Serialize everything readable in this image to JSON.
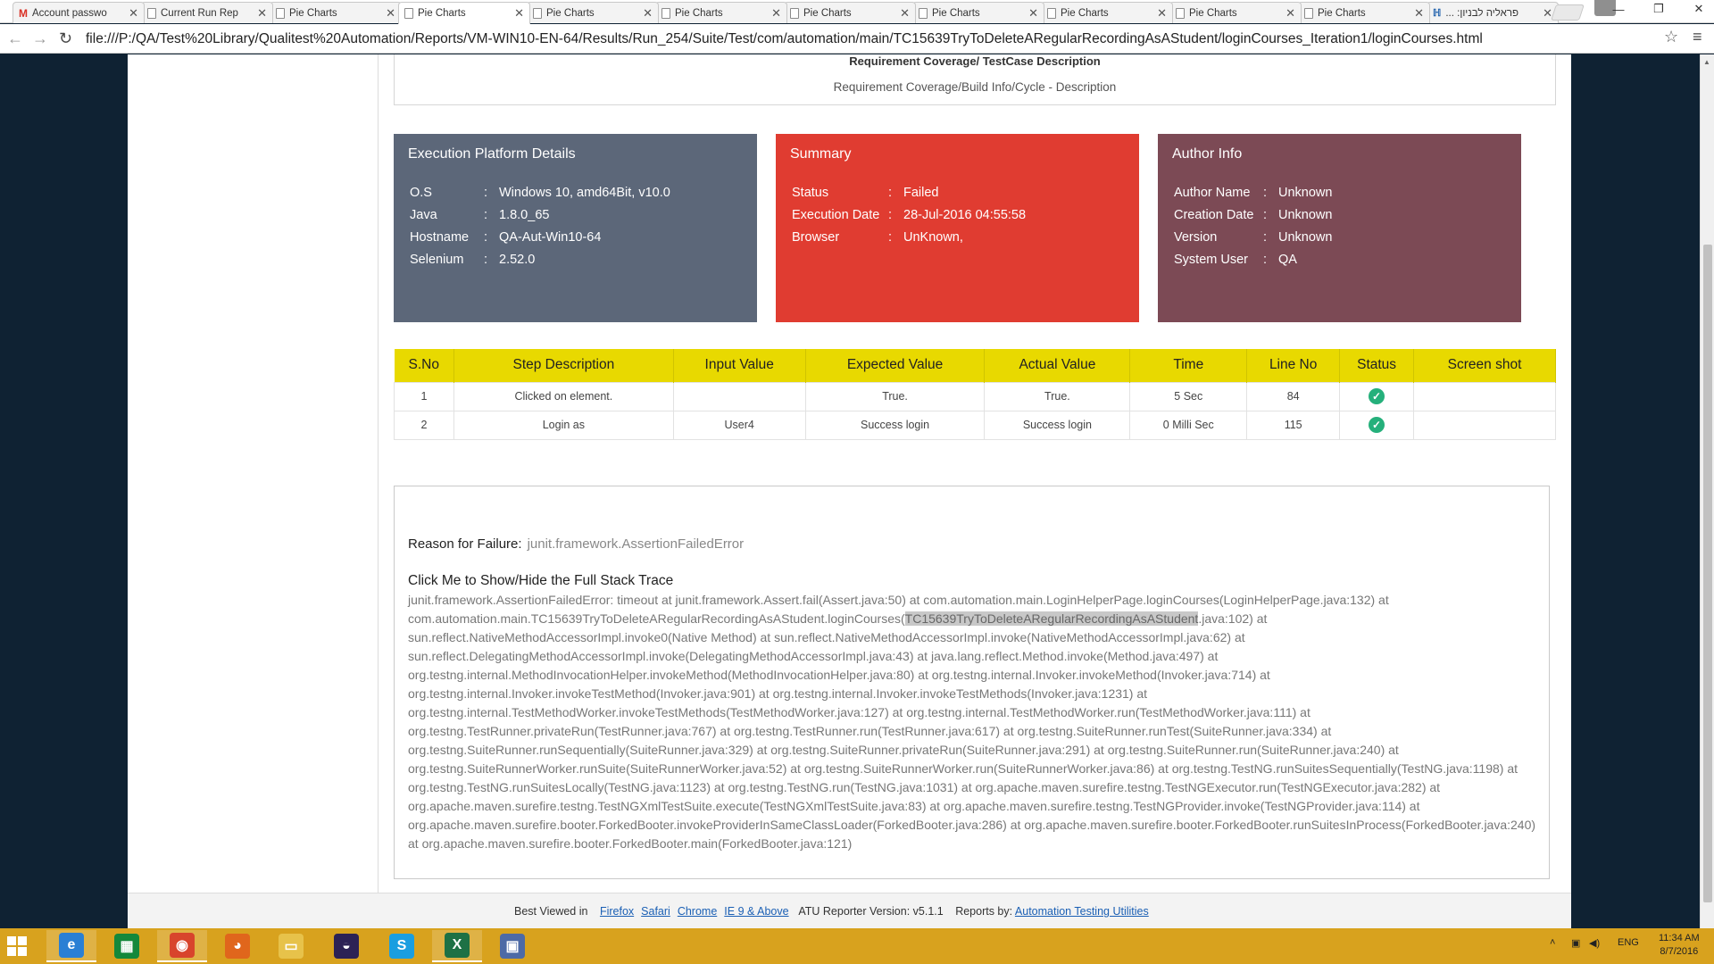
{
  "browser": {
    "tabs": [
      {
        "title": "Account passwo",
        "icon": "gmail-icon"
      },
      {
        "title": "Current Run Rep",
        "icon": "document-icon"
      },
      {
        "title": "Pie Charts",
        "icon": "document-icon"
      },
      {
        "title": "Pie Charts",
        "icon": "document-icon",
        "active": true
      },
      {
        "title": "Pie Charts",
        "icon": "document-icon"
      },
      {
        "title": "Pie Charts",
        "icon": "document-icon"
      },
      {
        "title": "Pie Charts",
        "icon": "document-icon"
      },
      {
        "title": "Pie Charts",
        "icon": "document-icon"
      },
      {
        "title": "Pie Charts",
        "icon": "document-icon"
      },
      {
        "title": "Pie Charts",
        "icon": "document-icon"
      },
      {
        "title": "Pie Charts",
        "icon": "document-icon"
      },
      {
        "title": "פראליה לבניון: ...",
        "icon": "app-icon"
      }
    ],
    "tab_close_glyph": "✕",
    "url": "file:///P:/QA/Test%20Library/Qualitest%20Automation/Reports/VM-WIN10-EN-64/Results/Run_254/Suite/Test/com/automation/main/TC15639TryToDeleteARegularRecordingAsAStudent/loginCourses_Iteration1/loginCourses.html",
    "controls": {
      "back": "←",
      "forward": "→",
      "reload": "↻",
      "star": "☆",
      "menu": "≡",
      "minimize": "—",
      "restore": "❐",
      "close": "✕"
    }
  },
  "report": {
    "description_title": "Requirement Coverage/ TestCase Description",
    "description_text": "Requirement Coverage/Build Info/Cycle - Description",
    "platform": {
      "title": "Execution Platform Details",
      "color": "#5c6779",
      "rows": [
        {
          "key": "O.S",
          "value": "Windows 10, amd64Bit, v10.0"
        },
        {
          "key": "Java",
          "value": "1.8.0_65"
        },
        {
          "key": "Hostname",
          "value": "QA-Aut-Win10-64"
        },
        {
          "key": "Selenium",
          "value": "2.52.0"
        }
      ]
    },
    "summary": {
      "title": "Summary",
      "color": "#e03c31",
      "rows": [
        {
          "key": "Status",
          "value": "Failed"
        },
        {
          "key": "Execution Date",
          "value": "28-Jul-2016 04:55:58"
        },
        {
          "key": "Browser",
          "value": "UnKnown,"
        }
      ]
    },
    "author": {
      "title": "Author Info",
      "color": "#7c4a55",
      "rows": [
        {
          "key": "Author Name",
          "value": "Unknown"
        },
        {
          "key": "Creation Date",
          "value": "Unknown"
        },
        {
          "key": "Version",
          "value": "Unknown"
        },
        {
          "key": "System User",
          "value": "QA"
        }
      ]
    },
    "separator": ":",
    "steps_table": {
      "header_color": "#e8d900",
      "headers": [
        "S.No",
        "Step Description",
        "Input Value",
        "Expected Value",
        "Actual Value",
        "Time",
        "Line No",
        "Status",
        "Screen shot"
      ],
      "rows": [
        {
          "sno": "1",
          "step": "Clicked on element.",
          "input": "",
          "expected": "True.",
          "actual": "True.",
          "time": "5 Sec",
          "line": "84",
          "status": "passed",
          "screenshot": ""
        },
        {
          "sno": "2",
          "step": "Login as",
          "input": "User4",
          "expected": "Success login",
          "actual": "Success login",
          "time": "0 Milli Sec",
          "line": "115",
          "status": "passed",
          "screenshot": ""
        }
      ],
      "status_glyph": "✓"
    },
    "failure": {
      "reason_label": "Reason for Failure:",
      "reason_value": "junit.framework.AssertionFailedError",
      "toggle_label": "Click Me to Show/Hide the Full Stack Trace",
      "stack_before": "junit.framework.AssertionFailedError: timeout at junit.framework.Assert.fail(Assert.java:50) at com.automation.main.LoginHelperPage.loginCourses(LoginHelperPage.java:132) at com.automation.main.TC15639TryToDeleteARegularRecordingAsAStudent.loginCourses(",
      "stack_highlight": "TC15639TryToDeleteARegularRecordingAsAStudent",
      "stack_after": ".java:102) at sun.reflect.NativeMethodAccessorImpl.invoke0(Native Method) at sun.reflect.NativeMethodAccessorImpl.invoke(NativeMethodAccessorImpl.java:62) at sun.reflect.DelegatingMethodAccessorImpl.invoke(DelegatingMethodAccessorImpl.java:43) at java.lang.reflect.Method.invoke(Method.java:497) at org.testng.internal.MethodInvocationHelper.invokeMethod(MethodInvocationHelper.java:80) at org.testng.internal.Invoker.invokeMethod(Invoker.java:714) at org.testng.internal.Invoker.invokeTestMethod(Invoker.java:901) at org.testng.internal.Invoker.invokeTestMethods(Invoker.java:1231) at org.testng.internal.TestMethodWorker.invokeTestMethods(TestMethodWorker.java:127) at org.testng.internal.TestMethodWorker.run(TestMethodWorker.java:111) at org.testng.TestRunner.privateRun(TestRunner.java:767) at org.testng.TestRunner.run(TestRunner.java:617) at org.testng.SuiteRunner.runTest(SuiteRunner.java:334) at org.testng.SuiteRunner.runSequentially(SuiteRunner.java:329) at org.testng.SuiteRunner.privateRun(SuiteRunner.java:291) at org.testng.SuiteRunner.run(SuiteRunner.java:240) at org.testng.SuiteRunnerWorker.runSuite(SuiteRunnerWorker.java:52) at org.testng.SuiteRunnerWorker.run(SuiteRunnerWorker.java:86) at org.testng.TestNG.runSuitesSequentially(TestNG.java:1198) at org.testng.TestNG.runSuitesLocally(TestNG.java:1123) at org.testng.TestNG.run(TestNG.java:1031) at org.apache.maven.surefire.testng.TestNGExecutor.run(TestNGExecutor.java:282) at org.apache.maven.surefire.testng.TestNGXmlTestSuite.execute(TestNGXmlTestSuite.java:83) at org.apache.maven.surefire.testng.TestNGProvider.invoke(TestNGProvider.java:114) at org.apache.maven.surefire.booter.ForkedBooter.invokeProviderInSameClassLoader(ForkedBooter.java:286) at org.apache.maven.surefire.booter.ForkedBooter.runSuitesInProcess(ForkedBooter.java:240) at org.apache.maven.surefire.booter.ForkedBooter.main(ForkedBooter.java:121)"
    },
    "footer": {
      "best_viewed": "Best Viewed in",
      "browsers": [
        "Firefox",
        "Safari",
        "Chrome",
        "IE 9 & Above"
      ],
      "version": "ATU Reporter Version:  v5.1.1",
      "reports_by": "Reports by:",
      "reports_by_link": "Automation Testing Utilities"
    }
  },
  "taskbar": {
    "apps": [
      {
        "name": "internet-explorer-icon",
        "glyph": "e",
        "color": "#2a7fd4",
        "open": true
      },
      {
        "name": "store-icon",
        "glyph": "▦",
        "color": "#14883b",
        "open": false
      },
      {
        "name": "chrome-icon",
        "glyph": "◉",
        "color": "#d8442c",
        "open": true
      },
      {
        "name": "firefox-icon",
        "glyph": "◕",
        "color": "#e0661c",
        "open": false
      },
      {
        "name": "file-explorer-icon",
        "glyph": "▭",
        "color": "#e7c24a",
        "open": false
      },
      {
        "name": "eclipse-icon",
        "glyph": "◒",
        "color": "#2c2255",
        "open": false
      },
      {
        "name": "skype-icon",
        "glyph": "S",
        "color": "#1a9ee0",
        "open": false
      },
      {
        "name": "excel-icon",
        "glyph": "X",
        "color": "#1e7145",
        "open": true
      },
      {
        "name": "network-app-icon",
        "glyph": "▣",
        "color": "#4d6aa6",
        "open": false
      }
    ],
    "tray_glyphs": {
      "chevron": "˄",
      "network": "▣",
      "volume": "◀)"
    },
    "language": "ENG",
    "time": "11:34 AM",
    "date": "8/7/2016"
  }
}
